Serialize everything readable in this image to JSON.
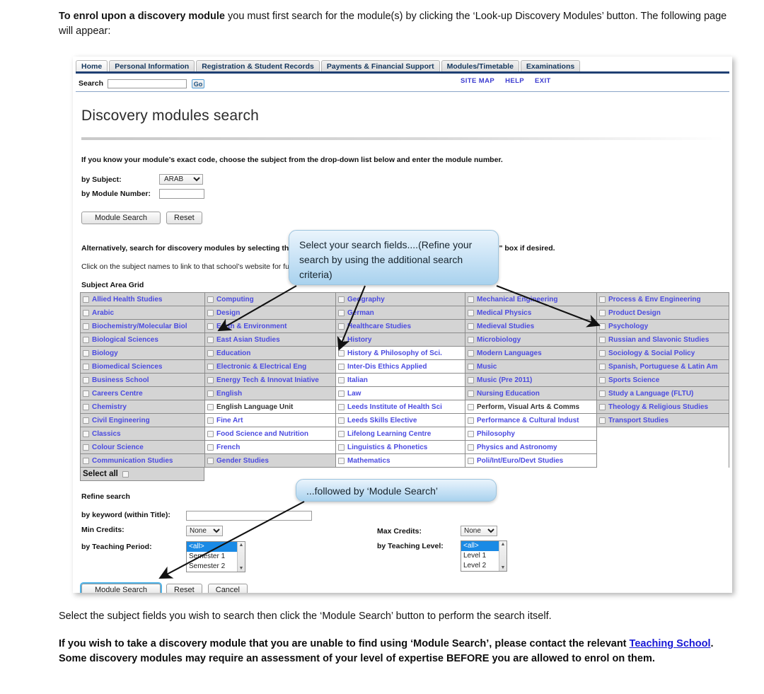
{
  "doc": {
    "intro_bold": "To enrol upon a discovery module",
    "intro_rest": " you must first search for the module(s) by clicking the ‘Look-up Discovery Modules’ button. The following page will appear:",
    "outro_1": "Select the subject fields you wish to search then click the ‘Module Search’ button to perform the search itself.",
    "outro_2_a": "If you wish to take a discovery module that you are unable to find using ‘Module Search’, please contact the relevant ",
    "outro_2_link": "Teaching School",
    "outro_2_b": ". Some discovery modules may require an assessment of your level of expertise BEFORE you are allowed to enrol on them."
  },
  "portal": {
    "tabs": [
      {
        "label": "Home",
        "active": true
      },
      {
        "label": "Personal Information",
        "active": false
      },
      {
        "label": "Registration & Student Records",
        "active": false
      },
      {
        "label": "Payments & Financial Support",
        "active": false
      },
      {
        "label": "Modules/Timetable",
        "active": false
      },
      {
        "label": "Examinations",
        "active": false
      }
    ],
    "search_label": "Search",
    "search_value": "",
    "search_placeholder": "",
    "go_label": "Go",
    "util_nav": [
      "SITE MAP",
      "HELP",
      "EXIT"
    ],
    "page_title": "Discovery modules search",
    "hint_exact_code": "If you know your module’s exact code, choose the subject from the drop-down list below and enter the module number.",
    "by_subject_label": "by Subject:",
    "by_subject_value": "ARAB",
    "by_module_number_label": "by Module Number:",
    "by_module_number_value": "",
    "top_module_search": "Module Search",
    "top_reset": "Reset",
    "alternatively_line": "Alternatively, search for discovery modules by selecting the subject areas below. You may also use the \"Refine search\" box if desired.",
    "click_subject_line": "Click on the subject names to link to that school’s website for further information.",
    "grid_caption": "Subject Area Grid",
    "select_all_label": "Select all",
    "refine_title": "Refine search",
    "keyword_label": "by keyword (within Title):",
    "keyword_value": "",
    "min_credits_label": "Min Credits:",
    "min_credits_value": "None",
    "max_credits_label": "Max Credits:",
    "max_credits_value": "None",
    "teaching_period_label": "by Teaching Period:",
    "teaching_period_options": [
      "<all>",
      "Semester 1",
      "Semester 2"
    ],
    "teaching_period_selected": "<all>",
    "teaching_level_label": "by Teaching Level:",
    "teaching_level_options": [
      "<all>",
      "Level 1",
      "Level 2"
    ],
    "teaching_level_selected": "<all>",
    "bottom_module_search": "Module Search",
    "bottom_reset": "Reset",
    "bottom_cancel": "Cancel",
    "subject_columns": [
      {
        "items": [
          {
            "label": "Allied Health Studies",
            "link": true
          },
          {
            "label": "Arabic",
            "link": true
          },
          {
            "label": "Biochemistry/Molecular Biol",
            "link": true
          },
          {
            "label": "Biological Sciences",
            "link": true
          },
          {
            "label": "Biology",
            "link": true
          },
          {
            "label": "Biomedical Sciences",
            "link": true
          },
          {
            "label": "Business School",
            "link": true
          },
          {
            "label": "Careers Centre",
            "link": true
          },
          {
            "label": "Chemistry",
            "link": true
          },
          {
            "label": "Civil Engineering",
            "link": true
          },
          {
            "label": "Classics",
            "link": true
          },
          {
            "label": "Colour Science",
            "link": true
          },
          {
            "label": "Communication Studies",
            "link": true
          }
        ]
      },
      {
        "items": [
          {
            "label": "Computing",
            "link": true
          },
          {
            "label": "Design",
            "link": true
          },
          {
            "label": "Earth & Environment",
            "link": true
          },
          {
            "label": "East Asian Studies",
            "link": true
          },
          {
            "label": "Education",
            "link": true
          },
          {
            "label": "Electronic & Electrical Eng",
            "link": true
          },
          {
            "label": "Energy Tech & Innovat Iniative",
            "link": true
          },
          {
            "label": "English",
            "link": true
          },
          {
            "label": "English Language Unit",
            "link": false
          },
          {
            "label": "Fine Art",
            "link": true
          },
          {
            "label": "Food Science and Nutrition",
            "link": true
          },
          {
            "label": "French",
            "link": true
          },
          {
            "label": "Gender Studies",
            "link": true
          }
        ]
      },
      {
        "items": [
          {
            "label": "Geography",
            "link": true
          },
          {
            "label": "German",
            "link": true
          },
          {
            "label": "Healthcare Studies",
            "link": true
          },
          {
            "label": "History",
            "link": true
          },
          {
            "label": "History & Philosophy of Sci.",
            "link": true
          },
          {
            "label": "Inter-Dis Ethics Applied",
            "link": true
          },
          {
            "label": "Italian",
            "link": true
          },
          {
            "label": "Law",
            "link": true
          },
          {
            "label": "Leeds Institute of Health Sci",
            "link": true
          },
          {
            "label": "Leeds Skills Elective",
            "link": true
          },
          {
            "label": "Lifelong Learning Centre",
            "link": true
          },
          {
            "label": "Linguistics & Phonetics",
            "link": true
          },
          {
            "label": "Mathematics",
            "link": true
          }
        ]
      },
      {
        "items": [
          {
            "label": "Mechanical Engineering",
            "link": true
          },
          {
            "label": "Medical Physics",
            "link": true
          },
          {
            "label": "Medieval Studies",
            "link": true
          },
          {
            "label": "Microbiology",
            "link": true
          },
          {
            "label": "Modern Languages",
            "link": true
          },
          {
            "label": "Music",
            "link": true
          },
          {
            "label": "Music (Pre 2011)",
            "link": true
          },
          {
            "label": "Nursing Education",
            "link": true
          },
          {
            "label": "Perform, Visual Arts & Comms",
            "link": false
          },
          {
            "label": "Performance & Cultural Indust",
            "link": true
          },
          {
            "label": "Philosophy",
            "link": true
          },
          {
            "label": "Physics and Astronomy",
            "link": true
          },
          {
            "label": "Poli/Int/Euro/Devt Studies",
            "link": true
          }
        ]
      },
      {
        "items": [
          {
            "label": "Process & Env Engineering",
            "link": true
          },
          {
            "label": "Product Design",
            "link": true
          },
          {
            "label": "Psychology",
            "link": true
          },
          {
            "label": "Russian and Slavonic Studies",
            "link": true
          },
          {
            "label": "Sociology & Social Policy",
            "link": true
          },
          {
            "label": "Spanish, Portuguese & Latin Am",
            "link": true
          },
          {
            "label": "Sports Science",
            "link": true
          },
          {
            "label": "Study a Language (FLTU)",
            "link": true
          },
          {
            "label": "Theology & Religious Studies",
            "link": true
          },
          {
            "label": "Transport Studies",
            "link": true
          }
        ]
      }
    ]
  },
  "callouts": {
    "fields": "Select your search fields....(Refine your search by using the additional search criteria)",
    "module_search": "...followed by ‘Module Search’"
  },
  "colors": {
    "link_blue": "#4b4be0",
    "tab_text": "#14365c",
    "rule_navy": "#1f3f73",
    "grid_cell_bg": "#d4d4d4",
    "callout_top": "#eaf4fc",
    "callout_bottom": "#a9d2ee",
    "listbox_selected": "#1a8ae5",
    "doc_link": "#1818d6"
  }
}
